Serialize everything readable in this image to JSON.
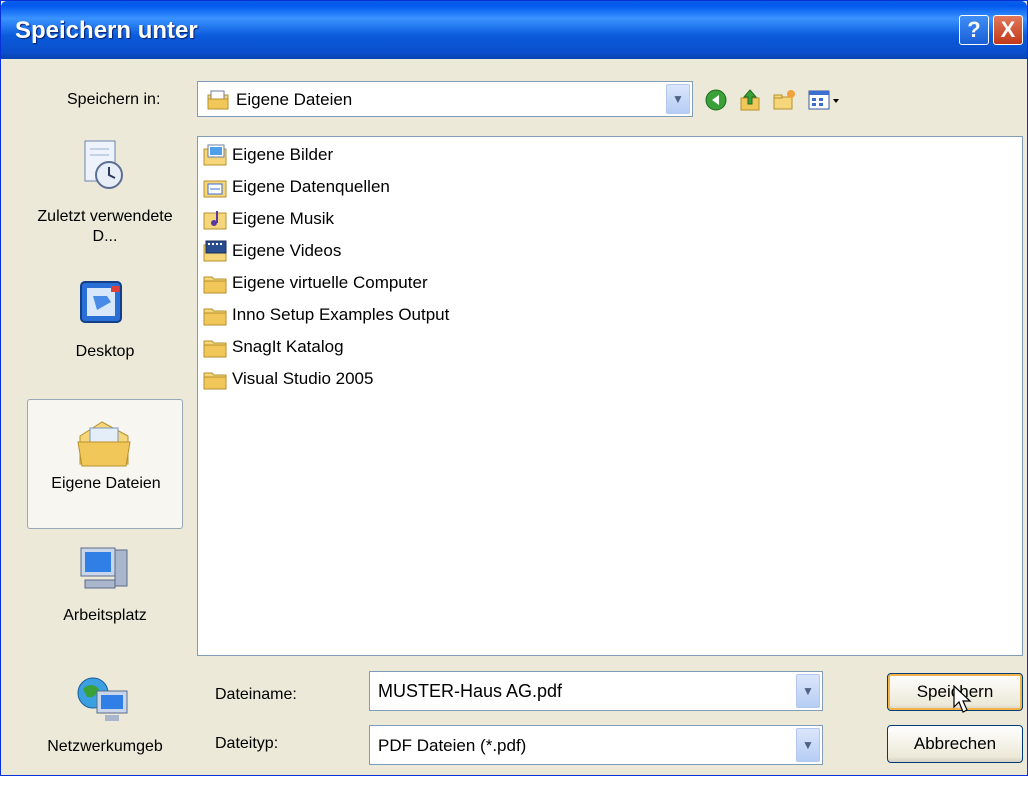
{
  "window": {
    "title": "Speichern unter"
  },
  "titlebar_buttons": {
    "help": "?",
    "close": "X"
  },
  "save_in": {
    "label": "Speichern in:",
    "value": "Eigene Dateien"
  },
  "toolbar": {
    "icons": [
      "back-icon",
      "up-folder-icon",
      "new-folder-icon",
      "view-menu-icon"
    ]
  },
  "places": [
    {
      "label": "Zuletzt verwendete D...",
      "icon": "recent-docs-icon"
    },
    {
      "label": "Desktop",
      "icon": "desktop-icon"
    },
    {
      "label": "Eigene Dateien",
      "icon": "my-documents-icon",
      "selected": true
    },
    {
      "label": "Arbeitsplatz",
      "icon": "my-computer-icon"
    },
    {
      "label": "Netzwerkumgeb",
      "icon": "network-icon"
    }
  ],
  "files": [
    {
      "name": "Eigene Bilder",
      "icon": "pictures-folder-icon"
    },
    {
      "name": "Eigene Datenquellen",
      "icon": "datasource-folder-icon"
    },
    {
      "name": "Eigene Musik",
      "icon": "music-folder-icon"
    },
    {
      "name": "Eigene Videos",
      "icon": "video-folder-icon"
    },
    {
      "name": "Eigene virtuelle Computer",
      "icon": "folder-icon"
    },
    {
      "name": "Inno Setup Examples Output",
      "icon": "folder-icon"
    },
    {
      "name": "SnagIt Katalog",
      "icon": "folder-icon"
    },
    {
      "name": "Visual Studio 2005",
      "icon": "folder-icon"
    }
  ],
  "filename": {
    "label": "Dateiname:",
    "value": "MUSTER-Haus AG.pdf"
  },
  "filetype": {
    "label": "Dateityp:",
    "value": "PDF Dateien (*.pdf)"
  },
  "buttons": {
    "save": "Speichern",
    "cancel": "Abbrechen"
  },
  "colors": {
    "title_blue": "#0a5bdc",
    "face": "#ece9d8",
    "border": "#7f9db9"
  }
}
